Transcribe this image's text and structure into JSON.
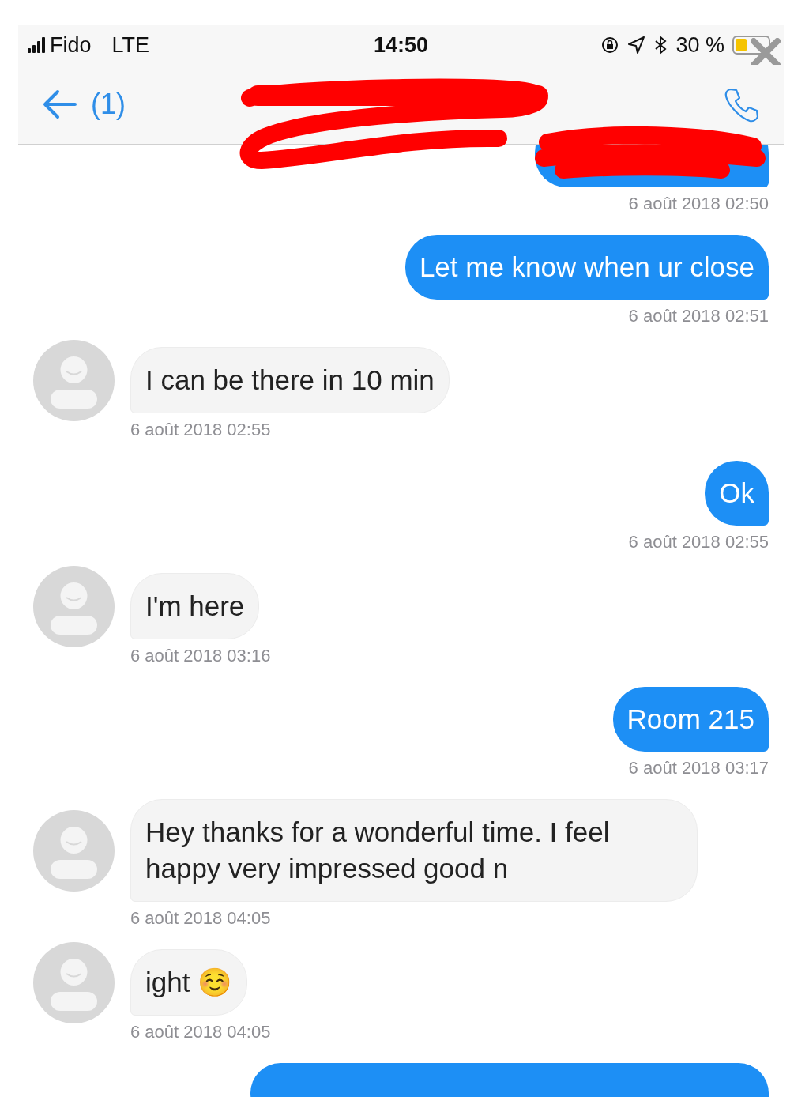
{
  "status_bar": {
    "carrier": "Fido",
    "network": "LTE",
    "time": "14:50",
    "battery": "30 %"
  },
  "nav": {
    "back_count": "(1)",
    "title_redacted": true
  },
  "messages": [
    {
      "kind": "sent",
      "redacted": true,
      "timestamp": "6 août 2018 02:50"
    },
    {
      "kind": "sent",
      "text": "Let me know when ur close",
      "timestamp": "6 août 2018 02:51"
    },
    {
      "kind": "received",
      "text": "I can be there in 10 min",
      "timestamp": "6 août 2018 02:55"
    },
    {
      "kind": "sent",
      "text": "Ok",
      "timestamp": "6 août 2018 02:55"
    },
    {
      "kind": "received",
      "text": "I'm here",
      "timestamp": "6 août 2018 03:16"
    },
    {
      "kind": "sent",
      "text": "Room 215",
      "timestamp": "6 août 2018 03:17"
    },
    {
      "kind": "received",
      "text": "Hey thanks for a wonderful time. I feel happy very impressed good n",
      "timestamp": "6 août 2018 04:05"
    },
    {
      "kind": "received",
      "text": "ight ☺️",
      "timestamp": "6 août 2018 04:05"
    },
    {
      "kind": "sent",
      "cut": true
    }
  ]
}
